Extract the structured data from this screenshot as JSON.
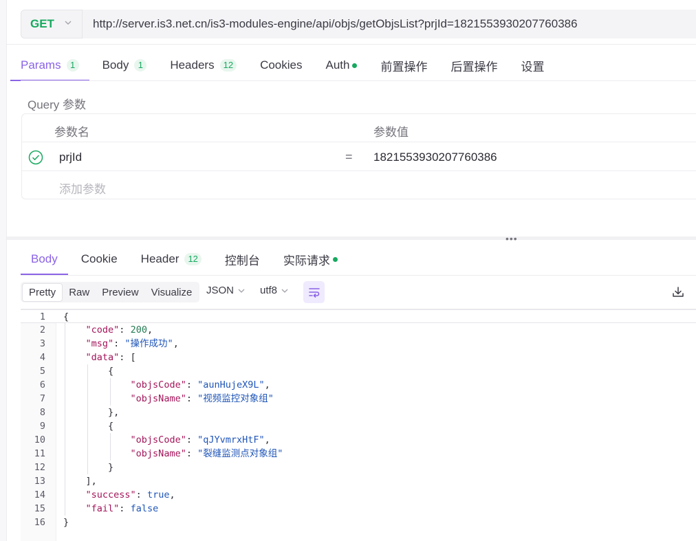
{
  "request": {
    "method": "GET",
    "url": "http://server.is3.net.cn/is3-modules-engine/api/objs/getObjsList?prjId=1821553930207760386"
  },
  "request_tabs": [
    {
      "label": "Params",
      "badge": "1",
      "active": true
    },
    {
      "label": "Body",
      "badge": "1"
    },
    {
      "label": "Headers",
      "badge": "12"
    },
    {
      "label": "Cookies"
    },
    {
      "label": "Auth",
      "dot": true
    },
    {
      "label": "前置操作"
    },
    {
      "label": "后置操作"
    },
    {
      "label": "设置"
    }
  ],
  "query": {
    "title": "Query 参数",
    "col_name": "参数名",
    "col_value": "参数值",
    "rows": [
      {
        "name": "prjId",
        "eq": "=",
        "value": "1821553930207760386"
      }
    ],
    "add_placeholder": "添加参数"
  },
  "splitter_grip": "•••",
  "response_tabs": [
    {
      "label": "Body",
      "active": true
    },
    {
      "label": "Cookie"
    },
    {
      "label": "Header",
      "badge": "12"
    },
    {
      "label": "控制台"
    },
    {
      "label": "实际请求",
      "dot": true
    }
  ],
  "view_modes": [
    "Pretty",
    "Raw",
    "Preview",
    "Visualize"
  ],
  "active_view_mode": "Pretty",
  "format_select": "JSON",
  "encoding_select": "utf8",
  "code_lines": [
    "1",
    "2",
    "3",
    "4",
    "5",
    "6",
    "7",
    "8",
    "9",
    "10",
    "11",
    "12",
    "13",
    "14",
    "15",
    "16"
  ],
  "response_json": {
    "code_key": "\"code\"",
    "code_val": "200",
    "msg_key": "\"msg\"",
    "msg_val": "\"操作成功\"",
    "data_key": "\"data\"",
    "item1_code_key": "\"objsCode\"",
    "item1_code_val": "\"aunHujeX9L\"",
    "item1_name_key": "\"objsName\"",
    "item1_name_val": "\"视频监控对象组\"",
    "item2_code_key": "\"objsCode\"",
    "item2_code_val": "\"qJYvmrxHtF\"",
    "item2_name_key": "\"objsName\"",
    "item2_name_val": "\"裂缝监测点对象组\"",
    "success_key": "\"success\"",
    "success_val": "true",
    "fail_key": "\"fail\"",
    "fail_val": "false"
  },
  "colors": {
    "accent": "#8a63e6",
    "success": "#17a95f"
  }
}
